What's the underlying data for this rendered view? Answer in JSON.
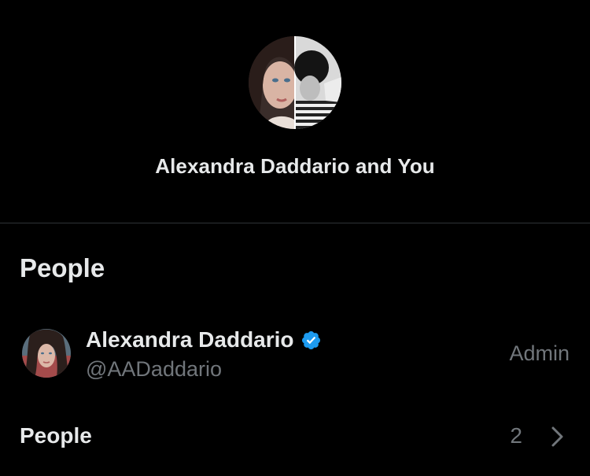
{
  "conversation": {
    "title": "Alexandra Daddario and You"
  },
  "people_section": {
    "heading": "People",
    "members": [
      {
        "name": "Alexandra Daddario",
        "handle": "@AADaddario",
        "role": "Admin",
        "verified": true
      }
    ],
    "summary_label": "People",
    "summary_count": "2"
  },
  "colors": {
    "background": "#000000",
    "primary_text": "#e7e9ea",
    "secondary_text": "#71767b",
    "divider": "#2f3336",
    "verified_badge": "#1d9bf0"
  },
  "icons": {
    "verified": "verified-badge-icon",
    "chevron": "chevron-right-icon"
  }
}
